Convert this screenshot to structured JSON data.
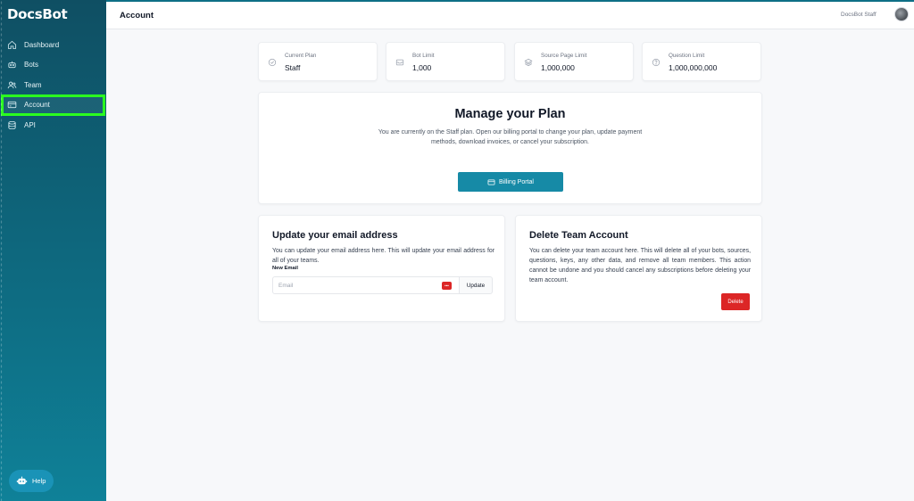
{
  "app": {
    "logo": "DocsBot"
  },
  "sidebar": {
    "items": [
      {
        "label": "Dashboard",
        "icon": "home-icon"
      },
      {
        "label": "Bots",
        "icon": "bot-icon"
      },
      {
        "label": "Team",
        "icon": "users-icon"
      },
      {
        "label": "Account",
        "icon": "credit-card-icon",
        "active": true
      },
      {
        "label": "API",
        "icon": "database-icon"
      }
    ],
    "help_label": "Help"
  },
  "header": {
    "title": "Account",
    "user_name": "DocsBot Staff"
  },
  "stats": [
    {
      "label": "Current Plan",
      "value": "Staff",
      "icon": "check-circle-icon"
    },
    {
      "label": "Bot Limit",
      "value": "1,000",
      "icon": "inbox-icon"
    },
    {
      "label": "Source Page Limit",
      "value": "1,000,000",
      "icon": "layers-icon"
    },
    {
      "label": "Question Limit",
      "value": "1,000,000,000",
      "icon": "question-circle-icon"
    }
  ],
  "manage": {
    "title": "Manage your Plan",
    "description": "You are currently on the Staff plan. Open our billing portal to change your plan, update payment methods, download invoices, or cancel your subscription.",
    "button_label": "Billing Portal"
  },
  "email": {
    "title": "Update your email address",
    "description": "You can update your email address here. This will update your email address for all of your teams.",
    "field_label": "New Email",
    "placeholder": "Email",
    "button_label": "Update"
  },
  "delete_team": {
    "title": "Delete Team Account",
    "description": "You can delete your team account here. This will delete all of your bots, sources, questions, keys, any other data, and remove all team members. This action cannot be undone and you should cancel any subscriptions before deleting your team account.",
    "button_label": "Delete"
  },
  "colors": {
    "accent": "#168aa6",
    "danger": "#dc2626",
    "active_outline": "#2bff1f",
    "sidebar": "#0e6a80"
  }
}
